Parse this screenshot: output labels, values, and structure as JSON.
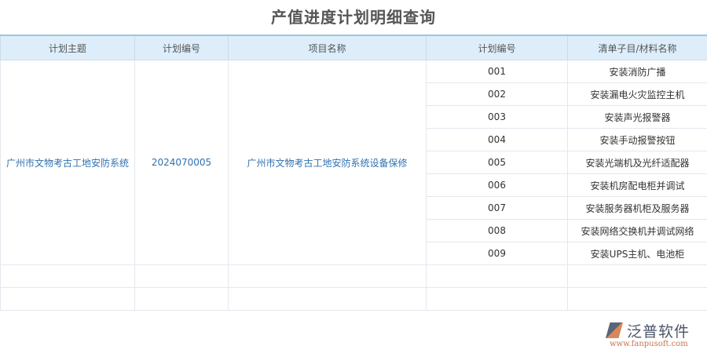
{
  "title": "产值进度计划明细查询",
  "columns": [
    "计划主题",
    "计划编号",
    "项目名称",
    "计划编号",
    "清单子目/材料名称"
  ],
  "group": {
    "theme": "广州市文物考古工地安防系统",
    "plan_no": "2024070005",
    "project": "广州市文物考古工地安防系统设备保修"
  },
  "rows": [
    {
      "no": "001",
      "item": "安装消防广播"
    },
    {
      "no": "002",
      "item": "安装漏电火灾监控主机"
    },
    {
      "no": "003",
      "item": "安装声光报警器"
    },
    {
      "no": "004",
      "item": "安装手动报警按钮"
    },
    {
      "no": "005",
      "item": "安装光端机及光纤适配器"
    },
    {
      "no": "006",
      "item": "安装机房配电柜并调试"
    },
    {
      "no": "007",
      "item": "安装服务器机柜及服务器"
    },
    {
      "no": "008",
      "item": "安装网络交换机并调试网络"
    },
    {
      "no": "009",
      "item": "安装UPS主机、电池柜"
    }
  ],
  "logo": {
    "name": "泛普软件",
    "url": "www.fanpusoft.com"
  }
}
